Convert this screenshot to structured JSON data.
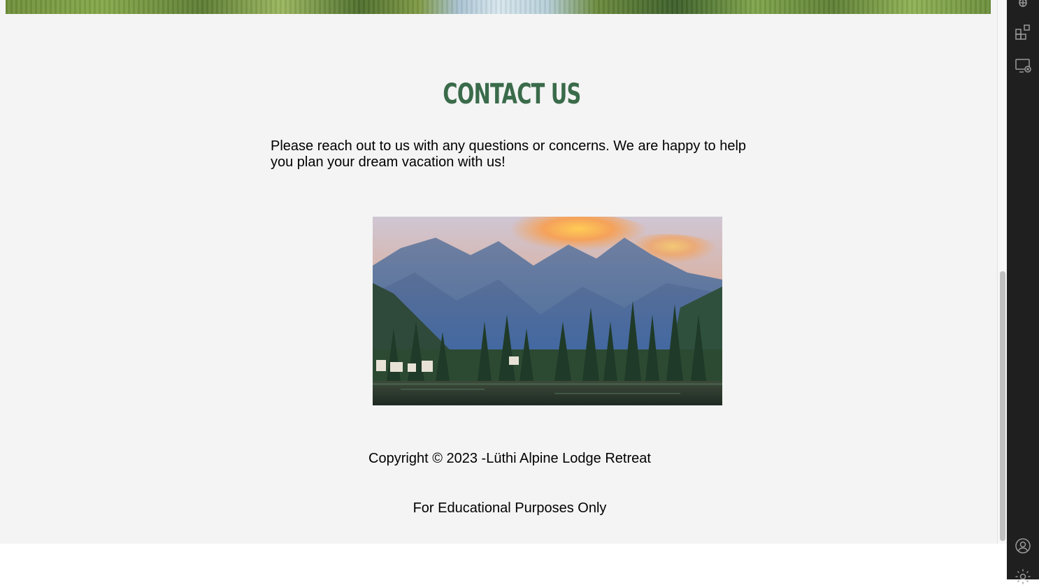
{
  "contact": {
    "title": "Contact Us",
    "text": "Please reach out to us with any questions or concerns. We are happy to help you plan your dream vacation with us!"
  },
  "footer": {
    "copyright": "Copyright © 2023 -Lüthi Alpine Lodge Retreat",
    "disclaimer": "For Educational Purposes Only"
  },
  "activity_bar": {
    "icons": [
      "debug-icon",
      "extensions-icon",
      "remote-explorer-icon",
      "account-icon",
      "settings-gear-icon"
    ]
  },
  "colors": {
    "title": "#3a6b4a",
    "page_background": "#f4f4f4",
    "activity_bar": "#1f1f1f"
  }
}
